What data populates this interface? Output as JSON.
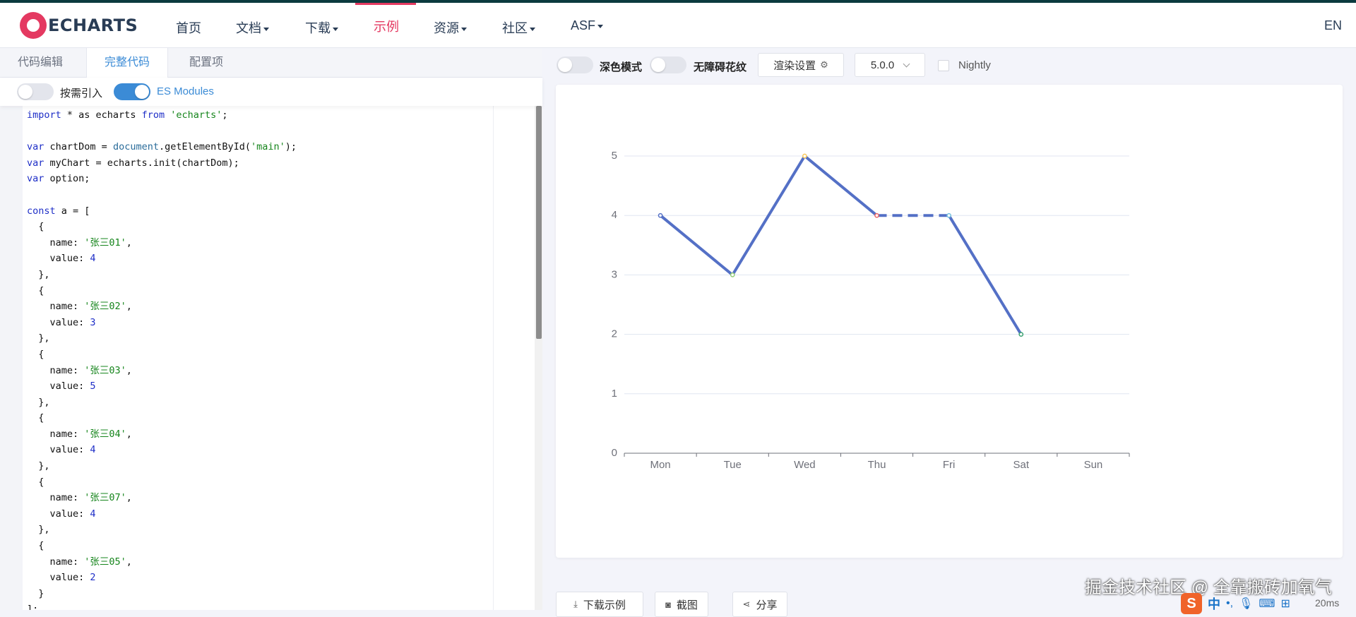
{
  "nav": {
    "logo_text": "ECHARTS",
    "items": [
      {
        "label": "首页",
        "dropdown": false
      },
      {
        "label": "文档",
        "dropdown": true
      },
      {
        "label": "下载",
        "dropdown": true
      },
      {
        "label": "示例",
        "dropdown": false,
        "active": true
      },
      {
        "label": "资源",
        "dropdown": true
      },
      {
        "label": "社区",
        "dropdown": true
      },
      {
        "label": "ASF",
        "dropdown": true
      }
    ],
    "lang": "EN"
  },
  "editor": {
    "tabs": [
      {
        "label": "代码编辑"
      },
      {
        "label": "完整代码",
        "active": true
      },
      {
        "label": "配置项"
      }
    ],
    "options": [
      {
        "label": "按需引入",
        "on": false
      },
      {
        "label": "ES Modules",
        "on": true
      }
    ],
    "code_lines": [
      "import * as echarts from 'echarts';",
      "",
      "var chartDom = document.getElementById('main');",
      "var myChart = echarts.init(chartDom);",
      "var option;",
      "",
      "const a = [",
      "  {",
      "    name: '张三01',",
      "    value: 4",
      "  },",
      "  {",
      "    name: '张三02',",
      "    value: 3",
      "  },",
      "  {",
      "    name: '张三03',",
      "    value: 5",
      "  },",
      "  {",
      "    name: '张三04',",
      "    value: 4",
      "  },",
      "  {",
      "    name: '张三07',",
      "    value: 4",
      "  },",
      "  {",
      "    name: '张三05',",
      "    value: 2",
      "  }",
      "];"
    ]
  },
  "toolbar": {
    "dark_mode_label": "深色模式",
    "aria_label": "无障碍花纹",
    "render_settings_label": "渲染设置",
    "version": "5.0.0",
    "nightly_label": "Nightly"
  },
  "bottom": {
    "download_label": "下载示例",
    "screenshot_label": "截图",
    "share_label": "分享"
  },
  "watermark": "掘金技术社区 @ 全靠搬砖加氧气",
  "timing": "20ms",
  "ime": {
    "logo": "S",
    "mode": "中"
  },
  "colors": {
    "line": "#5470c6",
    "accent": "#e43961",
    "blue": "#3b8bd6"
  },
  "chart_data": {
    "type": "line",
    "categories": [
      "Mon",
      "Tue",
      "Wed",
      "Thu",
      "Fri",
      "Sat",
      "Sun"
    ],
    "values": [
      4,
      3,
      5,
      4,
      4,
      2,
      null
    ],
    "dashed_segment": [
      "Thu",
      "Fri"
    ],
    "point_colors": [
      "#5470c6",
      "#91cc75",
      "#fac858",
      "#ee6666",
      "#73c0de",
      "#3ba272",
      null
    ],
    "y_ticks": [
      0,
      1,
      2,
      3,
      4,
      5
    ],
    "ylim": [
      0,
      5
    ],
    "grid": true,
    "title": "",
    "xlabel": "",
    "ylabel": ""
  }
}
